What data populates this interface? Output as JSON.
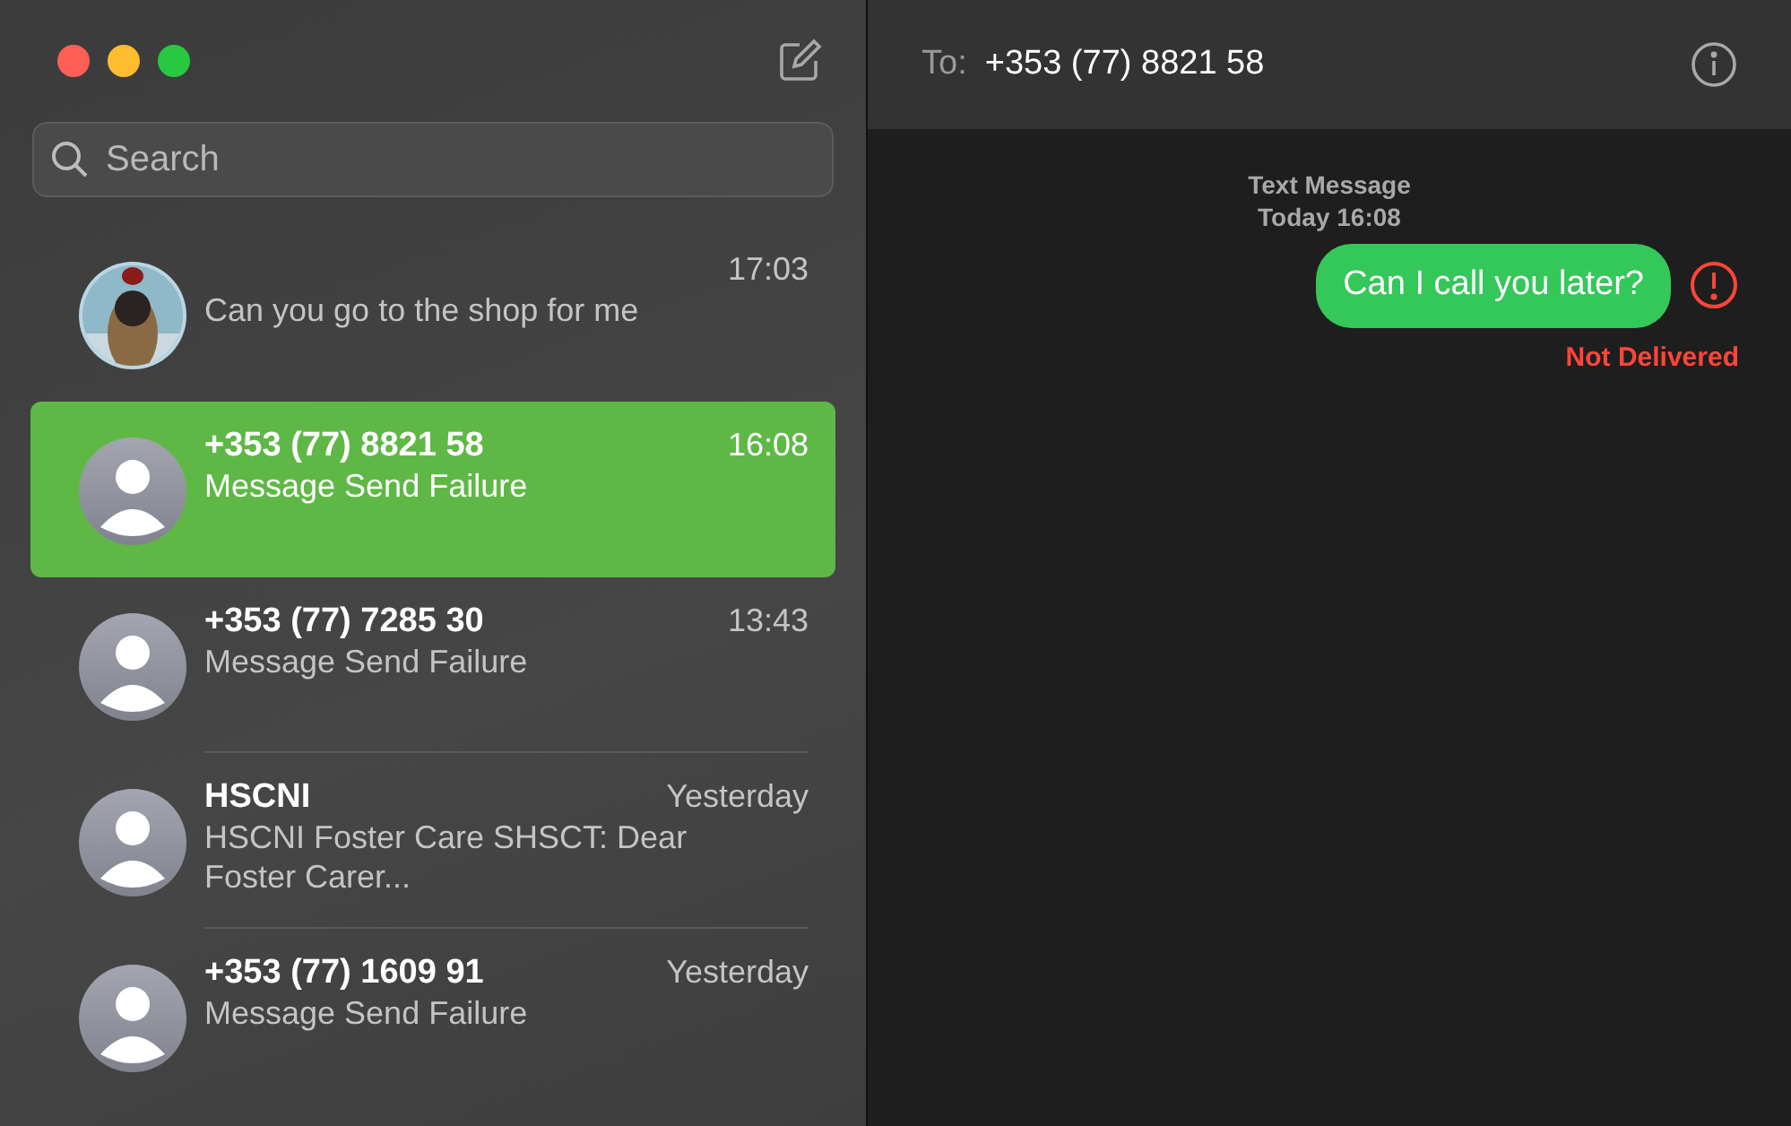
{
  "search": {
    "placeholder": "Search"
  },
  "conversations": [
    {
      "time": "17:03",
      "preview": "Can you go to the shop for me",
      "selected": false
    },
    {
      "kind": "contact",
      "name": "+353 (77) 8821 58",
      "time": "16:08",
      "preview": "Message Send Failure",
      "selected": true
    },
    {
      "kind": "contact",
      "name": "+353 (77) 7285 30",
      "time": "13:43",
      "preview": "Message Send Failure",
      "selected": false
    },
    {
      "kind": "contact",
      "name": "HSCNI",
      "time": "Yesterday",
      "preview": "HSCNI Foster Care SHSCT: Dear Foster Carer...",
      "selected": false
    },
    {
      "kind": "contact",
      "name": "+353 (77) 1609 91",
      "time": "Yesterday",
      "preview": "Message Send Failure",
      "selected": false
    }
  ],
  "header": {
    "to_label": "To:",
    "recipient": "+353 (77) 8821 58"
  },
  "thread": {
    "service": "Text Message",
    "timestamp": "Today 16:08",
    "messages": [
      {
        "text": "Can I call you later?",
        "delivered": false,
        "status": "Not Delivered"
      }
    ]
  }
}
